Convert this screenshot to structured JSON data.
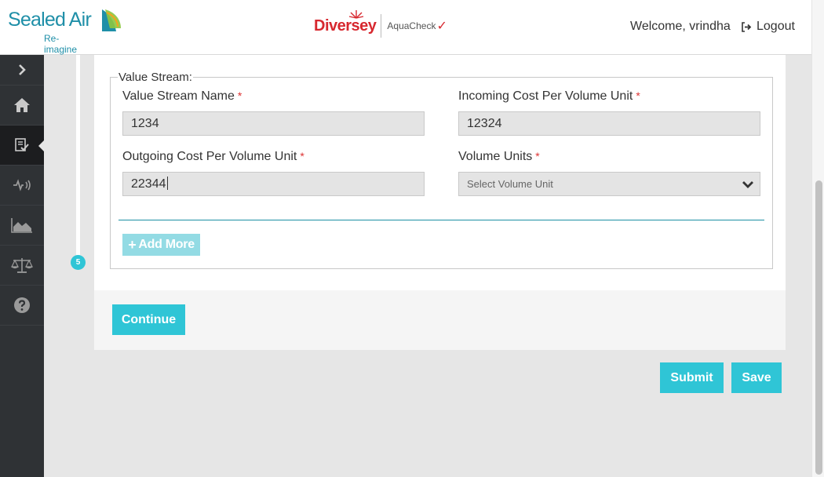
{
  "header": {
    "brand_name": "Sealed Air",
    "brand_tagline": "Re-imagine",
    "partner_name": "Diversey",
    "product_name": "AquaCheck",
    "welcome_text": "Welcome, vrindha",
    "logout_label": "Logout"
  },
  "sidebar": {
    "items": [
      {
        "icon": "chevron-right-icon"
      },
      {
        "icon": "home-icon"
      },
      {
        "icon": "checklist-icon",
        "active": true
      },
      {
        "icon": "signal-icon"
      },
      {
        "icon": "area-chart-icon"
      },
      {
        "icon": "scale-icon"
      },
      {
        "icon": "help-icon"
      }
    ]
  },
  "stepper": {
    "current_step": "5"
  },
  "form": {
    "legend": "Value Stream:",
    "fields": {
      "value_stream_name": {
        "label": "Value Stream Name",
        "required": "*",
        "value": "1234"
      },
      "incoming_cost": {
        "label": "Incoming Cost Per Volume Unit",
        "required": "*",
        "value": "12324"
      },
      "outgoing_cost": {
        "label": "Outgoing Cost Per Volume Unit",
        "required": "*",
        "value": "22344"
      },
      "volume_units": {
        "label": "Volume Units",
        "required": "*",
        "placeholder": "Select Volume Unit"
      }
    },
    "add_more_label": "Add More",
    "continue_label": "Continue"
  },
  "actions": {
    "submit_label": "Submit",
    "save_label": "Save"
  },
  "colors": {
    "accent": "#2fc5d6",
    "accent_light": "#93dbe4",
    "sidebar_bg": "#2f3235",
    "brand_teal": "#1f8fa8",
    "partner_red": "#d7282f"
  }
}
